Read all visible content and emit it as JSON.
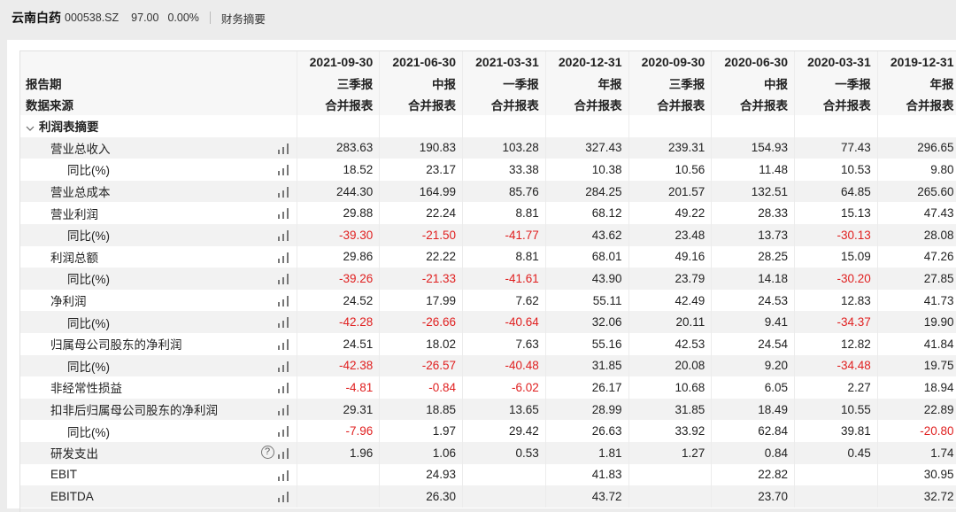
{
  "header": {
    "stock_name": "云南白药",
    "stock_code": "000538.SZ",
    "price": "97.00",
    "change_pct": "0.00%",
    "tab_label": "财务摘要"
  },
  "columns": [
    {
      "date": "2021-09-30",
      "period": "三季报",
      "source": "合并报表"
    },
    {
      "date": "2021-06-30",
      "period": "中报",
      "source": "合并报表"
    },
    {
      "date": "2021-03-31",
      "period": "一季报",
      "source": "合并报表"
    },
    {
      "date": "2020-12-31",
      "period": "年报",
      "source": "合并报表"
    },
    {
      "date": "2020-09-30",
      "period": "三季报",
      "source": "合并报表"
    },
    {
      "date": "2020-06-30",
      "period": "中报",
      "source": "合并报表"
    },
    {
      "date": "2020-03-31",
      "period": "一季报",
      "source": "合并报表"
    },
    {
      "date": "2019-12-31",
      "period": "年报",
      "source": "合并报表"
    }
  ],
  "row_labels": {
    "period": "报告期",
    "source": "数据来源",
    "section": "利润表摘要"
  },
  "rows": [
    {
      "label": "营业总收入",
      "sub": false,
      "values": [
        "283.63",
        "190.83",
        "103.28",
        "327.43",
        "239.31",
        "154.93",
        "77.43",
        "296.65"
      ]
    },
    {
      "label": "同比(%)",
      "sub": true,
      "values": [
        "18.52",
        "23.17",
        "33.38",
        "10.38",
        "10.56",
        "11.48",
        "10.53",
        "9.80"
      ]
    },
    {
      "label": "营业总成本",
      "sub": false,
      "values": [
        "244.30",
        "164.99",
        "85.76",
        "284.25",
        "201.57",
        "132.51",
        "64.85",
        "265.60"
      ]
    },
    {
      "label": "营业利润",
      "sub": false,
      "values": [
        "29.88",
        "22.24",
        "8.81",
        "68.12",
        "49.22",
        "28.33",
        "15.13",
        "47.43"
      ]
    },
    {
      "label": "同比(%)",
      "sub": true,
      "values": [
        "-39.30",
        "-21.50",
        "-41.77",
        "43.62",
        "23.48",
        "13.73",
        "-30.13",
        "28.08"
      ]
    },
    {
      "label": "利润总额",
      "sub": false,
      "values": [
        "29.86",
        "22.22",
        "8.81",
        "68.01",
        "49.16",
        "28.25",
        "15.09",
        "47.26"
      ]
    },
    {
      "label": "同比(%)",
      "sub": true,
      "values": [
        "-39.26",
        "-21.33",
        "-41.61",
        "43.90",
        "23.79",
        "14.18",
        "-30.20",
        "27.85"
      ]
    },
    {
      "label": "净利润",
      "sub": false,
      "values": [
        "24.52",
        "17.99",
        "7.62",
        "55.11",
        "42.49",
        "24.53",
        "12.83",
        "41.73"
      ]
    },
    {
      "label": "同比(%)",
      "sub": true,
      "values": [
        "-42.28",
        "-26.66",
        "-40.64",
        "32.06",
        "20.11",
        "9.41",
        "-34.37",
        "19.90"
      ]
    },
    {
      "label": "归属母公司股东的净利润",
      "sub": false,
      "values": [
        "24.51",
        "18.02",
        "7.63",
        "55.16",
        "42.53",
        "24.54",
        "12.82",
        "41.84"
      ]
    },
    {
      "label": "同比(%)",
      "sub": true,
      "values": [
        "-42.38",
        "-26.57",
        "-40.48",
        "31.85",
        "20.08",
        "9.20",
        "-34.48",
        "19.75"
      ]
    },
    {
      "label": "非经常性损益",
      "sub": false,
      "values": [
        "-4.81",
        "-0.84",
        "-6.02",
        "26.17",
        "10.68",
        "6.05",
        "2.27",
        "18.94"
      ]
    },
    {
      "label": "扣非后归属母公司股东的净利润",
      "sub": false,
      "values": [
        "29.31",
        "18.85",
        "13.65",
        "28.99",
        "31.85",
        "18.49",
        "10.55",
        "22.89"
      ]
    },
    {
      "label": "同比(%)",
      "sub": true,
      "values": [
        "-7.96",
        "1.97",
        "29.42",
        "26.63",
        "33.92",
        "62.84",
        "39.81",
        "-20.80"
      ]
    },
    {
      "label": "研发支出",
      "sub": false,
      "help": true,
      "values": [
        "1.96",
        "1.06",
        "0.53",
        "1.81",
        "1.27",
        "0.84",
        "0.45",
        "1.74"
      ]
    },
    {
      "label": "EBIT",
      "sub": false,
      "values": [
        "",
        "24.93",
        "",
        "41.83",
        "",
        "22.82",
        "",
        "30.95"
      ]
    },
    {
      "label": "EBITDA",
      "sub": false,
      "values": [
        "",
        "26.30",
        "",
        "43.72",
        "",
        "23.70",
        "",
        "32.72"
      ]
    }
  ],
  "icons": {
    "chart": "bar-chart-icon",
    "help": "help-icon",
    "chevron": "chevron-down-icon",
    "help_glyph": "?"
  },
  "colors": {
    "negative": "#e02020",
    "alt_row": "#f2f2f2"
  }
}
